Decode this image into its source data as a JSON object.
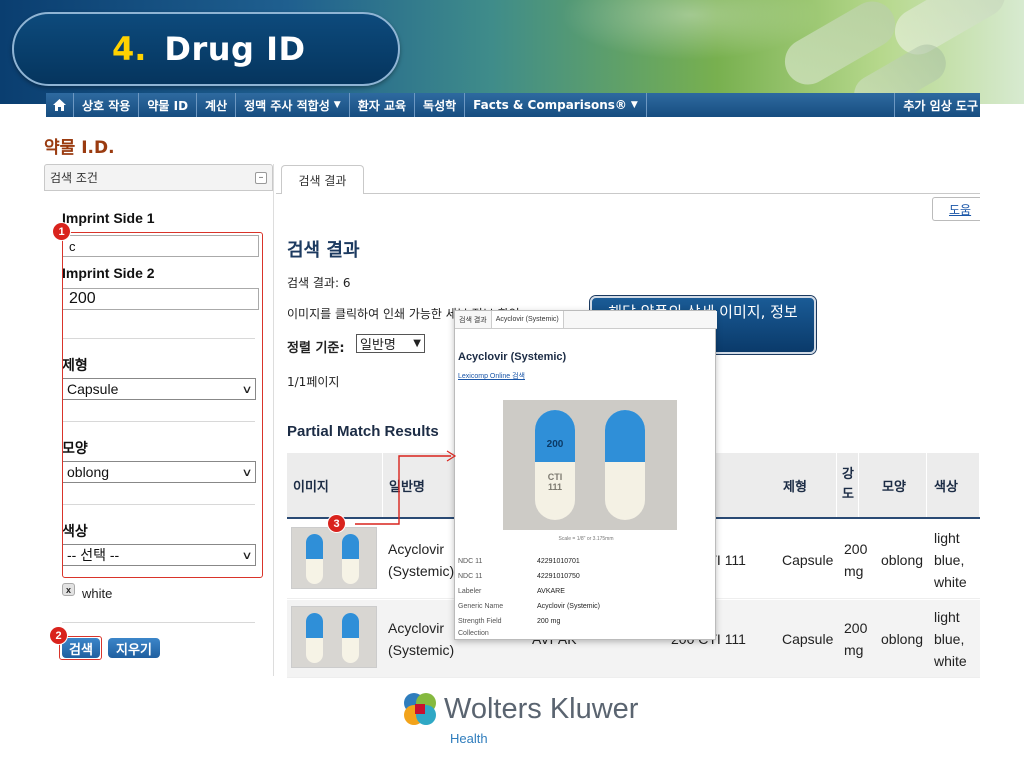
{
  "slide": {
    "number": "4.",
    "title": "Drug ID"
  },
  "nav": {
    "items": [
      "상호 작용",
      "약물 ID",
      "계산",
      "정맥 주사 적합성",
      "환자 교육",
      "독성학",
      "Facts & Comparisons®"
    ],
    "right": "추가 임상 도구"
  },
  "page": {
    "title": "약물 I.D."
  },
  "search_panel": {
    "header": "검색 조건",
    "imprint1_label": "Imprint Side 1",
    "imprint1_value": "c",
    "imprint2_label": "Imprint Side 2",
    "imprint2_value": "200",
    "form_label": "제형",
    "form_value": "Capsule",
    "shape_label": "모양",
    "shape_value": "oblong",
    "color_label": "색상",
    "color_value": "-- 선택 --",
    "selected_color_chip": "white",
    "chip_remove": "x",
    "search_button": "검색",
    "clear_button": "지우기"
  },
  "markers": [
    "1",
    "2",
    "3"
  ],
  "results": {
    "tab_label": "검색 결과",
    "help": "도움",
    "heading": "검색 결과",
    "count_text": "검색 결과: 6",
    "hint_text": "이미지를 클릭하여 인쇄 가능한 세부 정보 확인",
    "sort_label": "정렬 기준:",
    "sort_value": "일반명",
    "pagination": "1/1페이지",
    "partial_heading": "Partial Match Results",
    "columns": [
      "이미지",
      "일반명",
      "",
      "",
      "제형",
      "강도",
      "모양",
      "색상"
    ],
    "rows": [
      {
        "generic": "Acyclovir (Systemic)",
        "labeler": "",
        "imprint": "200 CTI 111",
        "form": "Capsule",
        "strength": "200 mg",
        "shape": "oblong",
        "color": "light blue, white"
      },
      {
        "generic": "Acyclovir (Systemic)",
        "labeler": "AVPAK",
        "imprint": "200 CTI 111",
        "form": "Capsule",
        "strength": "200 mg",
        "shape": "oblong",
        "color": "light blue, white"
      }
    ]
  },
  "callout": {
    "text": "해당 약품의 상세 이미지, 정보 제공"
  },
  "popup": {
    "tabs": [
      "검색 결과",
      "Acyclovir (Systemic)"
    ],
    "title": "Acyclovir (Systemic)",
    "link": "Lexicomp Online 검색",
    "pill_imprint_top": "200",
    "pill_imprint_bottom": "CTI 111",
    "scale": "Scale = 1/8\" or 3.175mm",
    "details": [
      {
        "k": "NDC 11",
        "v": "42291010701"
      },
      {
        "k": "NDC 11",
        "v": "42291010750"
      },
      {
        "k": "Labeler",
        "v": "AVKARE"
      },
      {
        "k": "Generic Name",
        "v": "Acyclovir (Systemic)"
      },
      {
        "k": "Strength Field",
        "v": "200 mg"
      },
      {
        "k": "Collection",
        "v": ""
      }
    ]
  },
  "footer": {
    "brand": "Wolters Kluwer",
    "sub": "Health"
  },
  "colors": {
    "nav": "#174d80",
    "accent_red": "#d9231d",
    "title_yellow": "#ffd200",
    "pill_blue": "#2f8fd8",
    "page_title": "#9a3b10"
  }
}
